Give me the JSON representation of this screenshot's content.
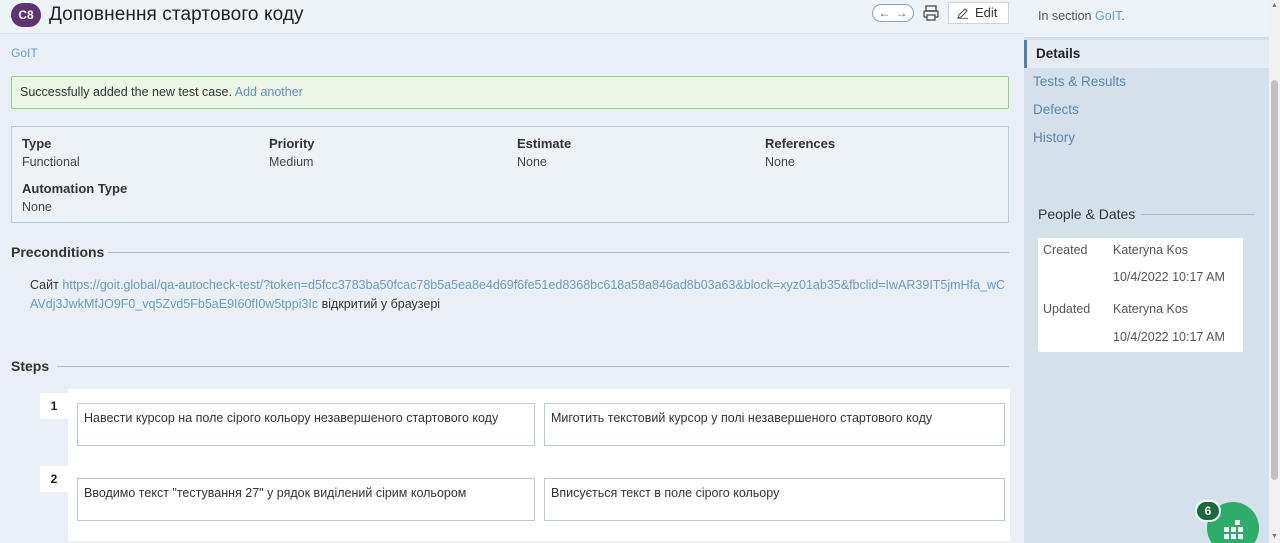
{
  "header": {
    "case_id": "C8",
    "title": "Доповнення стартового коду",
    "edit_label": "Edit",
    "nav_prev": "←",
    "nav_next": "→"
  },
  "section_breadcrumb": "GoIT",
  "success_message": {
    "text": "Successfully added the new test case.",
    "link": "Add another"
  },
  "fields": {
    "type": {
      "label": "Type",
      "value": "Functional"
    },
    "priority": {
      "label": "Priority",
      "value": "Medium"
    },
    "estimate": {
      "label": "Estimate",
      "value": "None"
    },
    "references": {
      "label": "References",
      "value": "None"
    },
    "automation_type": {
      "label": "Automation Type",
      "value": "None"
    }
  },
  "preconditions": {
    "heading": "Preconditions",
    "prefix": "Сайт",
    "url": "https://goit.global/qa-autocheck-test/?token=d5fcc3783ba50fcac78b5a5ea8e4d69f6fe51ed8368bc618a58a846ad8b03a63&block=xyz01ab35&fbclid=IwAR39IT5jmHfa_wCAVdj3JwkMfJO9F0_vq5Zvd5Fb5aE9I60fI0w5tppi3Ic",
    "suffix": "відкритий у браузері"
  },
  "steps": {
    "heading": "Steps",
    "items": [
      {
        "num": "1",
        "action": "Навести курсор на поле сірого кольору незавершеного стартового коду",
        "expected": "Миготить текстовий курсор у полі незавершеного стартового коду"
      },
      {
        "num": "2",
        "action": "Вводимо текст \"тестування 27\" у рядок виділений сірим кольором",
        "expected": "Вписується текст в поле сірого кольору"
      }
    ]
  },
  "sidebar": {
    "in_section_prefix": "In section",
    "in_section_link": "GoIT",
    "in_section_suffix": ".",
    "nav": [
      "Details",
      "Tests & Results",
      "Defects",
      "History"
    ],
    "people_heading": "People & Dates",
    "created_label": "Created",
    "created_by": "Kateryna Kos",
    "created_date": "10/4/2022 10:17 AM",
    "updated_label": "Updated",
    "updated_by": "Kateryna Kos",
    "updated_date": "10/4/2022 10:17 AM"
  },
  "fab_badge": "6",
  "colors": {
    "case_badge": "#5b3472",
    "link": "#5a8fb8",
    "success_bg": "#eaf6e6",
    "success_border": "#98cc8a",
    "sidebar_bg": "#d5e1ea",
    "fab": "#2cae6a"
  }
}
